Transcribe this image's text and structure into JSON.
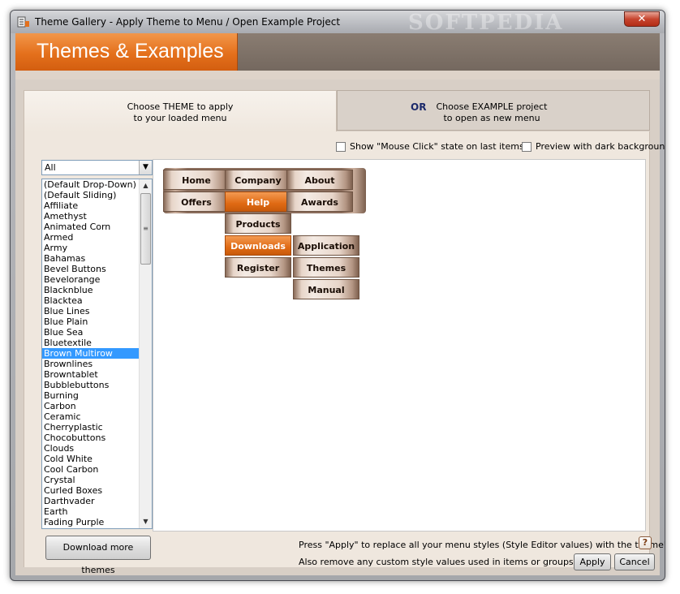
{
  "window": {
    "title": "Theme Gallery - Apply Theme to Menu / Open Example Project",
    "watermark": "SOFTPEDIA",
    "close_symbol": "✕"
  },
  "header": {
    "title": "Themes & Examples"
  },
  "choose_theme": {
    "line1": "Choose THEME to apply",
    "line2": "to your loaded menu"
  },
  "choose_example": {
    "or_label": "OR",
    "line1": "Choose EXAMPLE project",
    "line2": "to open as new menu"
  },
  "options": {
    "mouse_click_label": "Show \"Mouse Click\" state on last items",
    "dark_bg_label": "Preview with dark background"
  },
  "filter": {
    "selected": "All",
    "arrow": "▼"
  },
  "theme_list": {
    "items": [
      "(Default Drop-Down)",
      "(Default Sliding)",
      "Affiliate",
      "Amethyst",
      "Animated Corn",
      "Armed",
      "Army",
      "Bahamas",
      "Bevel Buttons",
      "Bevelorange",
      "Blacknblue",
      "Blacktea",
      "Blue Lines",
      "Blue Plain",
      "Blue Sea",
      "Bluetextile",
      "Brown Multirow",
      "Brownlines",
      "Browntablet",
      "Bubblebuttons",
      "Burning",
      "Carbon",
      "Ceramic",
      "Cherryplastic",
      "Chocobuttons",
      "Clouds",
      "Cold White",
      "Cool Carbon",
      "Crystal",
      "Curled Boxes",
      "Darthvader",
      "Earth",
      "Fading Purple"
    ],
    "selected_index": 16,
    "scroll_up": "▲",
    "scroll_down": "▼",
    "thumb_grip": "≡"
  },
  "preview_menu": {
    "home": "Home",
    "company": "Company",
    "about": "About",
    "offers": "Offers",
    "help": "Help",
    "awards": "Awards",
    "products": "Products",
    "downloads": "Downloads",
    "register": "Register",
    "application": "Application",
    "themes": "Themes",
    "manual": "Manual"
  },
  "footer": {
    "apply_note": "Press \"Apply\" to replace all your menu styles (Style Editor values) with the theme's styles.",
    "help_symbol": "?",
    "remove_label": "Also remove any custom style values used in items or groups:",
    "download_label": "Download more themes",
    "apply_label": "Apply",
    "cancel_label": "Cancel"
  }
}
